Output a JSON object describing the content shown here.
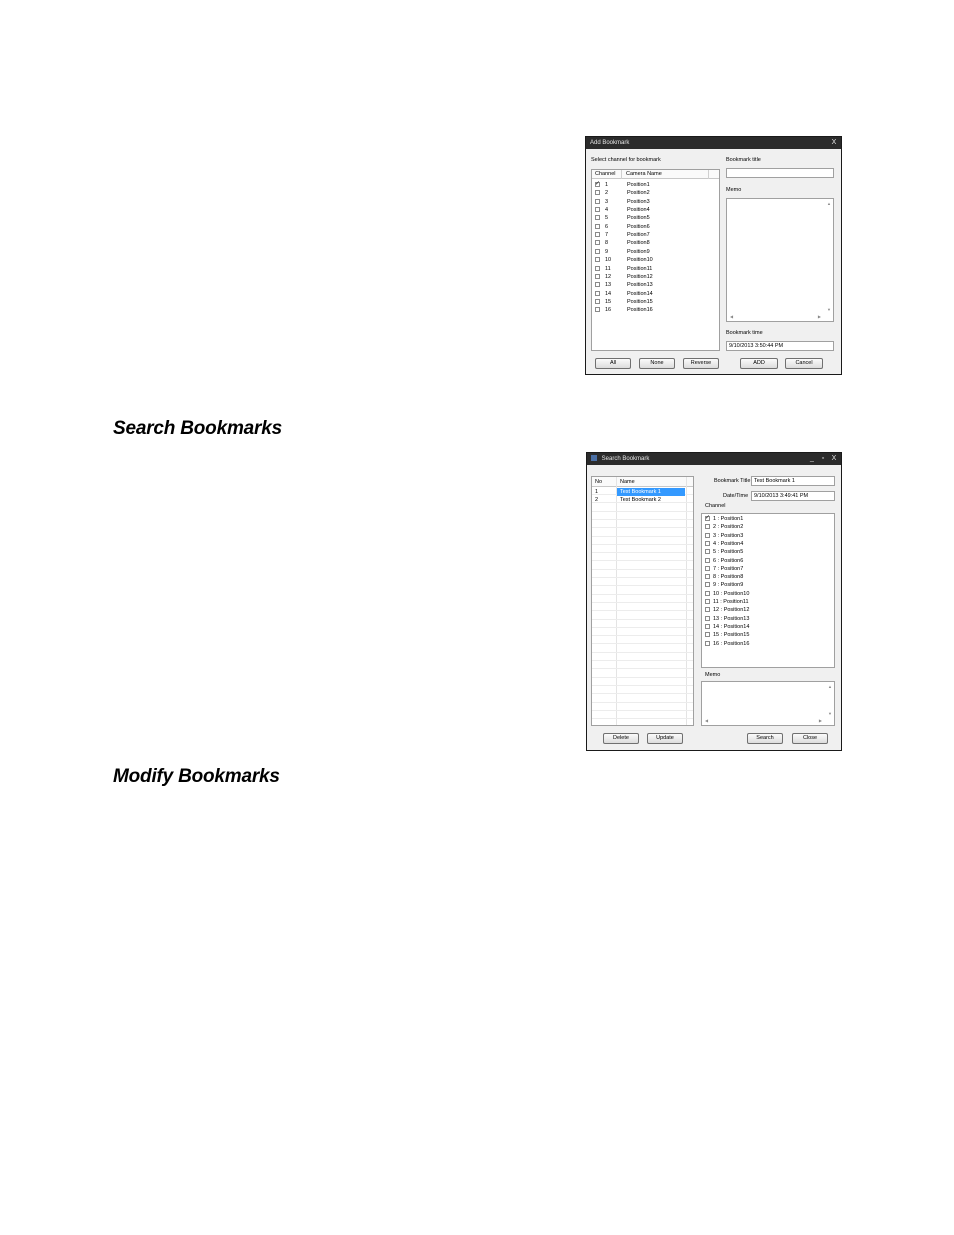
{
  "headings": {
    "search": "Search Bookmarks",
    "modify": "Modify Bookmarks"
  },
  "add_bookmark": {
    "title": "Add Bookmark",
    "close": "X",
    "select_channel_label": "Select channel for bookmark",
    "col_channel": "Channel",
    "col_camera": "Camera Name",
    "channels": [
      {
        "num": "1",
        "name": "Position1",
        "checked": true
      },
      {
        "num": "2",
        "name": "Position2",
        "checked": false
      },
      {
        "num": "3",
        "name": "Position3",
        "checked": false
      },
      {
        "num": "4",
        "name": "Position4",
        "checked": false
      },
      {
        "num": "5",
        "name": "Position5",
        "checked": false
      },
      {
        "num": "6",
        "name": "Position6",
        "checked": false
      },
      {
        "num": "7",
        "name": "Position7",
        "checked": false
      },
      {
        "num": "8",
        "name": "Position8",
        "checked": false
      },
      {
        "num": "9",
        "name": "Position9",
        "checked": false
      },
      {
        "num": "10",
        "name": "Position10",
        "checked": false
      },
      {
        "num": "11",
        "name": "Position11",
        "checked": false
      },
      {
        "num": "12",
        "name": "Position12",
        "checked": false
      },
      {
        "num": "13",
        "name": "Position13",
        "checked": false
      },
      {
        "num": "14",
        "name": "Position14",
        "checked": false
      },
      {
        "num": "15",
        "name": "Position15",
        "checked": false
      },
      {
        "num": "16",
        "name": "Position16",
        "checked": false
      }
    ],
    "bookmark_title_label": "Bookmark title",
    "bookmark_title_value": "",
    "memo_label": "Memo",
    "bookmark_time_label": "Bookmark time",
    "bookmark_time_value": "9/10/2013 3:50:44 PM",
    "btn_all": "All",
    "btn_none": "None",
    "btn_reverse": "Reverse",
    "btn_add": "ADD",
    "btn_cancel": "Cancel"
  },
  "search_bookmark": {
    "title": "Search Bookmark",
    "minimize": "_",
    "maximize": "▫",
    "close": "X",
    "col_no": "No",
    "col_name": "Name",
    "rows": [
      {
        "no": "1",
        "name": "Test Bookmark 1",
        "selected": true
      },
      {
        "no": "2",
        "name": "Test Bookmark 2",
        "selected": false
      }
    ],
    "bookmark_title_label": "Bookmark Title",
    "bookmark_title_value": "Test Bookmark 1",
    "datetime_label": "Date/Time",
    "datetime_value": "9/10/2013 3:49:41 PM",
    "channel_label": "Channel",
    "channels": [
      {
        "label": "1 : Position1",
        "checked": true
      },
      {
        "label": "2 : Position2",
        "checked": false
      },
      {
        "label": "3 : Position3",
        "checked": false
      },
      {
        "label": "4 : Position4",
        "checked": false
      },
      {
        "label": "5 : Position5",
        "checked": false
      },
      {
        "label": "6 : Position6",
        "checked": false
      },
      {
        "label": "7 : Position7",
        "checked": false
      },
      {
        "label": "8 : Position8",
        "checked": false
      },
      {
        "label": "9 : Position9",
        "checked": false
      },
      {
        "label": "10 : Position10",
        "checked": false
      },
      {
        "label": "11 : Position11",
        "checked": false
      },
      {
        "label": "12 : Position12",
        "checked": false
      },
      {
        "label": "13 : Position13",
        "checked": false
      },
      {
        "label": "14 : Position14",
        "checked": false
      },
      {
        "label": "15 : Position15",
        "checked": false
      },
      {
        "label": "16 : Position16",
        "checked": false
      }
    ],
    "memo_label": "Memo",
    "btn_delete": "Delete",
    "btn_update": "Update",
    "btn_search": "Search",
    "btn_close": "Close"
  }
}
